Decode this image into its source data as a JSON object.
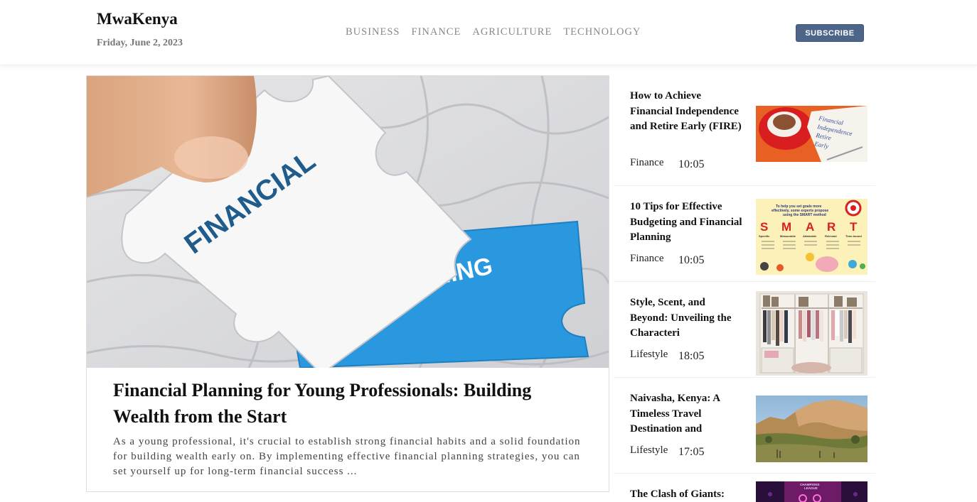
{
  "header": {
    "brand": "MwaKenya",
    "date": "Friday, June 2, 2023",
    "nav": [
      "BUSINESS",
      "FINANCE",
      "AGRICULTURE",
      "TECHNOLOGY"
    ],
    "subscribe_label": "SUBSCRIBE"
  },
  "featured": {
    "image_words": [
      "FINANCIAL",
      "PLANNING"
    ],
    "title": "Financial Planning for Young Professionals: Building Wealth from the Start",
    "excerpt": "As a young professional, it's crucial to establish strong financial habits and a solid foundation for building wealth early on. By implementing effective financial planning strategies, you can set yourself up for long-term financial success ..."
  },
  "sidebar": {
    "items": [
      {
        "title": "How to Achieve Financial Independence and Retire Early (FIRE)",
        "category": "Finance",
        "time": "10:05",
        "thumb_text": [
          "Financial",
          "Independence",
          "Retire",
          "Early"
        ]
      },
      {
        "title": "10 Tips for Effective Budgeting and Financial Planning",
        "category": "Finance",
        "time": "10:05",
        "thumb_text": [
          "To help you set goals more",
          "effectively, some experts propose",
          "using the SMART method",
          "S",
          "M",
          "A",
          "R",
          "T",
          "Specific",
          "Measurable",
          "Attainable",
          "Relevant",
          "Time-bound"
        ]
      },
      {
        "title": "Style, Scent, and Beyond: Unveiling the Characteri",
        "category": "Lifestyle",
        "time": "18:05"
      },
      {
        "title": "Naivasha, Kenya: A Timeless Travel Destination and",
        "category": "Lifestyle",
        "time": "17:05"
      },
      {
        "title": "The Clash of Giants:",
        "category": "",
        "time": "",
        "thumb_text": [
          "CHAMPIONS",
          "LEAGUE"
        ]
      }
    ]
  },
  "colors": {
    "accent": "#4d6589",
    "puzzle_blue": "#2a98de",
    "text_muted": "#777777"
  }
}
